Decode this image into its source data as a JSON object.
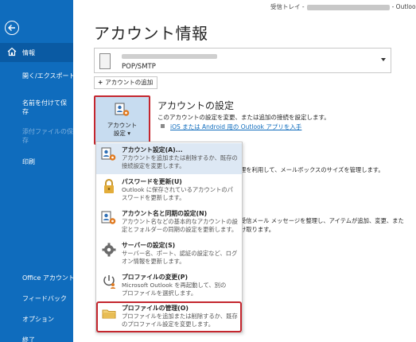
{
  "titlebar": {
    "folder": "受信トレイ -",
    "app": "- Outlook"
  },
  "nav": {
    "items": [
      {
        "label": "情報"
      },
      {
        "label": "開く/エクスポート"
      },
      {
        "label": "名前を付けて保"
      },
      {
        "label": "存"
      },
      {
        "label": "添付ファイルの保"
      },
      {
        "label": "存"
      },
      {
        "label": "印刷"
      },
      {
        "label": "Office アカウント"
      },
      {
        "label": "フィードバック"
      },
      {
        "label": "オプション"
      },
      {
        "label": "終了"
      }
    ]
  },
  "main": {
    "title": "アカウント情報",
    "account_protocol": "POP/SMTP",
    "add_account_label": "アカウントの追加",
    "account_settings_button": {
      "line1": "アカウント",
      "line2": "設定"
    },
    "section_title": "アカウントの設定",
    "section_desc": "このアカウントの設定を変更、または追加の接続を設定します。",
    "section_link": "iOS または Android 用の Outlook アプリを入手",
    "bg_text_1": "理を利用して、メールボックスのサイズを管理します。",
    "bg_text_2": "受信メール メッセージを整理し、アイテムが追加、変更、また",
    "bg_text_3": "け取ります。"
  },
  "menu": {
    "items": [
      {
        "title": "アカウント設定(A)...",
        "desc1": "アカウントを追加または削除するか、既存の",
        "desc2": "接続設定を変更します。",
        "icon": "account-settings-icon"
      },
      {
        "title": "パスワードを更新(U)",
        "desc1": "Outlook に保存されているアカウントのパ",
        "desc2": "スワードを更新します。",
        "icon": "lock-icon"
      },
      {
        "title": "アカウント名と同期の設定(N)",
        "desc1": "アカウント名などの基本的なアカウントの設",
        "desc2": "定とフォルダーの同期の設定を更新します。",
        "icon": "account-sync-icon"
      },
      {
        "title": "サーバーの設定(S)",
        "desc1": "サーバー名、ポート、認証の設定など、ログ",
        "desc2": "オン情報を更新します。",
        "icon": "gear-icon"
      },
      {
        "title": "プロファイルの変更(P)",
        "desc1": "Microsoft Outlook を再起動して、別の",
        "desc2": "プロファイルを選択します。",
        "icon": "change-profile-icon"
      },
      {
        "title": "プロファイルの管理(O)",
        "desc1": "プロファイルを追加または削除するか、既存",
        "desc2": "のプロファイル設定を変更します。",
        "icon": "manage-profile-icon"
      }
    ]
  },
  "colors": {
    "nav_bg": "#0f6cbd",
    "highlight": "#c4262e",
    "link": "#0f6cbd"
  }
}
